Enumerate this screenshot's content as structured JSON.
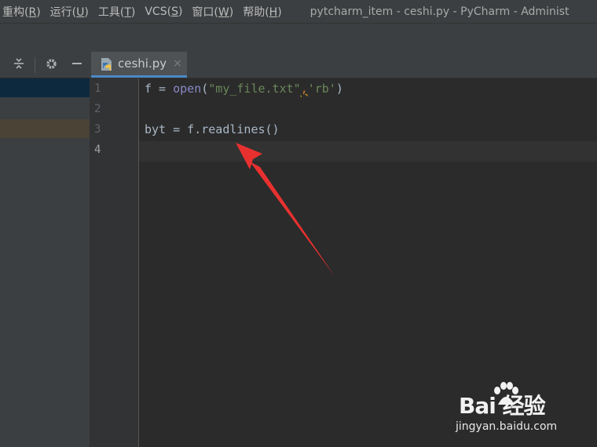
{
  "menubar": {
    "items": [
      {
        "label": "重构(",
        "key": "R",
        "tail": ")"
      },
      {
        "label": "运行(",
        "key": "U",
        "tail": ")"
      },
      {
        "label": "工具(",
        "key": "T",
        "tail": ")"
      },
      {
        "label": "VCS(",
        "key": "S",
        "tail": ")"
      },
      {
        "label": "窗口(",
        "key": "W",
        "tail": ")"
      },
      {
        "label": "帮助(",
        "key": "H",
        "tail": ")"
      }
    ],
    "window_title": "pytcharm_item - ceshi.py - PyCharm - Administ"
  },
  "left_panel": {
    "icons": [
      "collapse-all-icon",
      "gear-icon",
      "minimize-icon"
    ]
  },
  "tabs": [
    {
      "label": "ceshi.py",
      "icon": "python-file-icon",
      "close": "×"
    }
  ],
  "editor": {
    "line_numbers": [
      "1",
      "2",
      "3",
      "4"
    ],
    "current_line": 4,
    "lines": {
      "l1": {
        "a": "f = ",
        "b": "open",
        "c": "(",
        "d": "\"my_file.txt\"",
        "e": ",",
        "f": "'rb'",
        "g": ")"
      },
      "l3": "byt = f.readlines()"
    }
  },
  "annotation": {
    "type": "red-arrow",
    "color": "#e8312f"
  },
  "watermark": {
    "logo_text": "Bai  经验",
    "url": "jingyan.baidu.com"
  },
  "colors": {
    "background": "#2b2b2b",
    "panel": "#3c3f41",
    "tab_underline": "#4a88c7",
    "builtin": "#8888c6",
    "string": "#6a8759"
  }
}
